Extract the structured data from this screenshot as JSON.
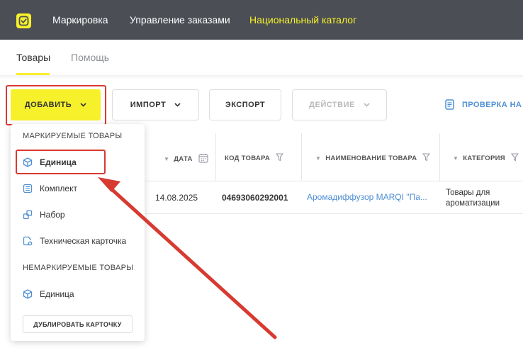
{
  "topbar": {
    "logo_icon": "check-square-icon",
    "nav": [
      "Маркировка",
      "Управление заказами",
      "Национальный каталог"
    ],
    "active_index": 2,
    "accent": "#f6f12b",
    "bg": "#4b4e55"
  },
  "tabs": [
    "Товары",
    "Помощь"
  ],
  "toolbar": {
    "add": "ДОБАВИТЬ",
    "import": "ИМПОРТ",
    "export": "ЭКСПОРТ",
    "action": "ДЕЙСТВИЕ",
    "check": "ПРОВЕРКА НА"
  },
  "table": {
    "columns": [
      "ДАТА",
      "КОД ТОВАРА",
      "НАИМЕНОВАНИЕ ТОВАРА",
      "КАТЕГОРИЯ"
    ],
    "rows": [
      {
        "date": "14.08.2025",
        "code": "04693060292001",
        "name": "Аромадиффузор MARQI \"Па...",
        "category": "Товары для ароматизации"
      }
    ]
  },
  "dropdown": {
    "marked_header": "МАРКИРУЕМЫЕ ТОВАРЫ",
    "marked_items": [
      {
        "label": "Единица",
        "icon": "cube-icon"
      },
      {
        "label": "Комплект",
        "icon": "list-box-icon"
      },
      {
        "label": "Набор",
        "icon": "boxes-icon"
      },
      {
        "label": "Техническая карточка",
        "icon": "tech-card-icon"
      }
    ],
    "unmarked_header": "НЕМАРКИРУЕМЫЕ ТОВАРЫ",
    "unmarked_items": [
      {
        "label": "Единица",
        "icon": "cube-icon"
      }
    ],
    "duplicate": "ДУБЛИРОВАТЬ КАРТОЧКУ"
  },
  "annotation_color": "#d73a31",
  "link_color": "#4f8fd3"
}
